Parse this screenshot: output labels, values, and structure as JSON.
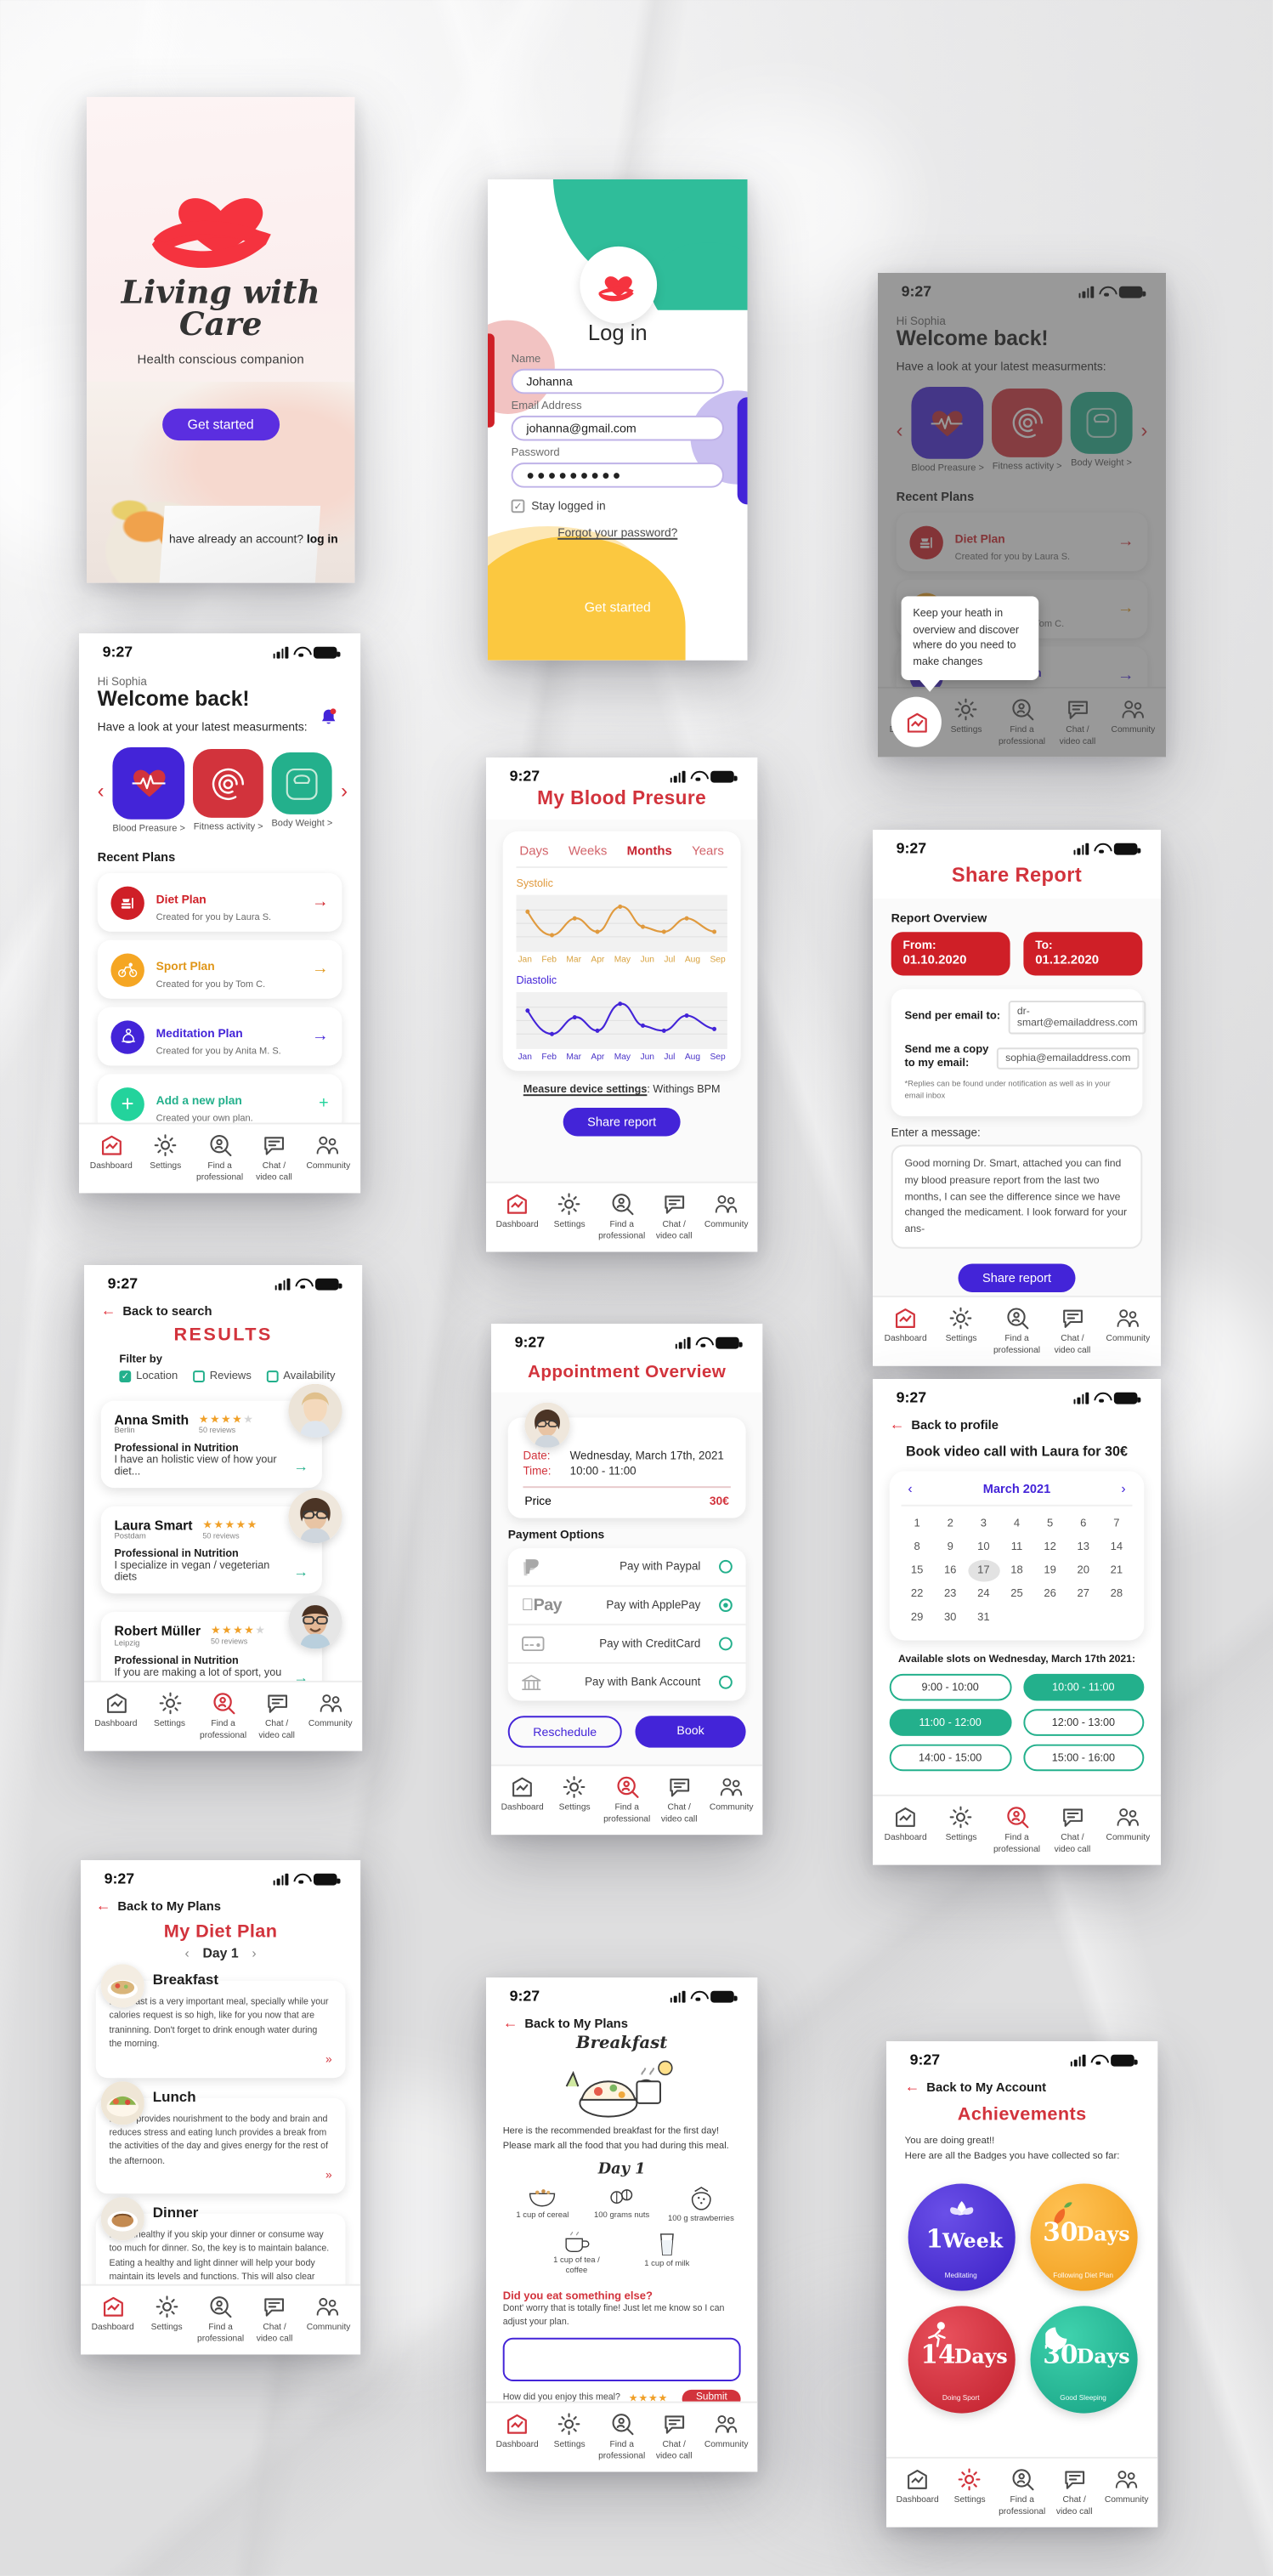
{
  "meta": {
    "status_time": "9:27"
  },
  "tabbar": {
    "items": [
      {
        "label": "Dashboard",
        "icon": "dashboard-icon"
      },
      {
        "label": "Settings",
        "icon": "gear-icon"
      },
      {
        "label": "Find a\nprofessional",
        "icon": "search-person-icon"
      },
      {
        "label": "Chat /\nvideo call",
        "icon": "chat-icon"
      },
      {
        "label": "Community",
        "icon": "community-icon"
      }
    ],
    "labels": {
      "dashboard": "Dashboard",
      "settings": "Settings",
      "find_line1": "Find a",
      "find_line2": "professional",
      "chat_line1": "Chat /",
      "chat_line2": "video call",
      "community": "Community"
    }
  },
  "splash": {
    "title_line1": "Living with",
    "title_line2": "Care",
    "tagline": "Health conscious companion",
    "cta": "Get started",
    "account_prompt": "have already an account?",
    "account_link": "log in",
    "logo_icon": "heart-in-hand-icon"
  },
  "login": {
    "title": "Log in",
    "name_label": "Name",
    "name_value": "Johanna",
    "email_label": "Email Address",
    "email_value": "johanna@gmail.com",
    "password_label": "Password",
    "password_value": "●●●●●●●●●",
    "stay_logged_in": "Stay logged in",
    "stay_checked": true,
    "forgot": "Forgot your password?",
    "cta": "Get started",
    "logo_icon": "heart-in-hand-icon"
  },
  "dashboard": {
    "greeting": "Hi Sophia",
    "welcome": "Welcome back!",
    "subtitle": "Have a look at your latest measurments:",
    "tiles": [
      {
        "label": "Blood Preasure >",
        "color": "#4324d8",
        "icon": "heartbeat-icon"
      },
      {
        "label": "Fitness activity >",
        "color": "#d2333c",
        "icon": "activity-rings-icon"
      },
      {
        "label": "Body Weight >",
        "color": "#23b08c",
        "icon": "scale-icon"
      }
    ],
    "recent_plans_title": "Recent Plans",
    "plans": [
      {
        "name": "Diet Plan",
        "by": "Created for you by Laura S.",
        "color": "#cf1f27",
        "icon": "food-icon",
        "arrow": "→"
      },
      {
        "name": "Sport Plan",
        "by": "Created for you by Tom C.",
        "color": "#f5a623",
        "icon": "bike-icon",
        "arrow": "→"
      },
      {
        "name": "Meditation Plan",
        "by": "Created for you by Anita M. S.",
        "color": "#4324d8",
        "icon": "meditation-icon",
        "arrow": "→"
      },
      {
        "name": "Add a new plan",
        "by": "Created your own plan.",
        "color": "#23b08c",
        "icon": "plus-icon",
        "arrow": "+"
      }
    ],
    "tooltip": "Keep your heath in overview and discover where do you need to make changes",
    "bell_icon": "notification-bell-icon"
  },
  "blood_pressure": {
    "title": "My Blood Presure",
    "segments": [
      "Days",
      "Weeks",
      "Months",
      "Years"
    ],
    "active_segment": "Months",
    "device_label": "Measure device settings",
    "device_value": "Withings BPM",
    "share_cta": "Share report",
    "chart_data": [
      {
        "type": "line",
        "title": "Systolic",
        "categories": [
          "Jan",
          "Feb",
          "Mar",
          "Apr",
          "May",
          "Jun",
          "Jul",
          "Aug",
          "Sep"
        ],
        "values": [
          132,
          118,
          128,
          119,
          136,
          124,
          120,
          127,
          119
        ],
        "color": "#e09a3e",
        "xlabel": "",
        "ylabel": "",
        "ylim": [
          110,
          140
        ],
        "grid": true,
        "legend": "none"
      },
      {
        "type": "line",
        "title": "Diastolic",
        "categories": [
          "Jan",
          "Feb",
          "Mar",
          "Apr",
          "May",
          "Jun",
          "Jul",
          "Aug",
          "Sep"
        ],
        "values": [
          86,
          74,
          82,
          76,
          90,
          80,
          77,
          85,
          79
        ],
        "color": "#4324d8",
        "xlabel": "",
        "ylabel": "",
        "ylim": [
          70,
          92
        ],
        "grid": true,
        "legend": "none"
      }
    ]
  },
  "share_report": {
    "title": "Share Report",
    "overview_label": "Report Overview",
    "from_label": "From:",
    "from_value": "01.10.2020",
    "to_label": "To:",
    "to_value": "01.12.2020",
    "send_to_label": "Send per email to:",
    "send_to_value": "dr-smart@emailaddress.com",
    "copy_label_l1": "Send me a copy",
    "copy_label_l2": "to my email:",
    "copy_value": "sophia@emailaddress.com",
    "note": "*Replies can be found under notification as well as in your email inbox",
    "message_label": "Enter a message:",
    "message_value": "Good morning Dr. Smart, attached you can find my blood preasure report from the last two months, I can see the difference since we have changed the medicament. I look forward for your ans-",
    "share_cta": "Share report"
  },
  "results": {
    "back": "Back to search",
    "title": "RESULTS",
    "filter_label": "Filter by",
    "filters": [
      {
        "label": "Location",
        "checked": true
      },
      {
        "label": "Reviews",
        "checked": false
      },
      {
        "label": "Availability",
        "checked": false
      }
    ],
    "people": [
      {
        "name": "Anna Smith",
        "city": "Berlin",
        "stars": 4,
        "reviews": "50 reviews",
        "profession": "Professional in Nutrition",
        "desc": "I have an holistic view of how your diet..."
      },
      {
        "name": "Laura Smart",
        "city": "Postdam",
        "stars": 5,
        "reviews": "50 reviews",
        "profession": "Professional in Nutrition",
        "desc": "I specialize in vegan / vegeterian diets"
      },
      {
        "name": "Robert Müller",
        "city": "Leipzig",
        "stars": 4,
        "reviews": "50 reviews",
        "profession": "Professional in Nutrition",
        "desc": "If you are making a lot of sport, you pro-"
      }
    ]
  },
  "appointment": {
    "title": "Appointment Overview",
    "date_label": "Date:",
    "date_value": "Wednesday, March 17th, 2021",
    "time_label": "Time:",
    "time_value": "10:00 - 11:00",
    "price_label": "Price",
    "price_value": "30€",
    "payment_title": "Payment Options",
    "options": [
      {
        "label": "Pay with Paypal",
        "icon": "paypal-icon",
        "selected": false
      },
      {
        "label": "Pay with ApplePay",
        "icon": "applepay-icon",
        "selected": true
      },
      {
        "label": "Pay with CreditCard",
        "icon": "creditcard-icon",
        "selected": false
      },
      {
        "label": "Pay with Bank Account",
        "icon": "bank-icon",
        "selected": false
      }
    ],
    "reschedule": "Reschedule",
    "book": "Book"
  },
  "booking": {
    "back": "Back to profile",
    "heading": "Book video call with Laura for 30€",
    "month": "March 2021",
    "prev": "‹",
    "next": "›",
    "days": [
      "1",
      "2",
      "3",
      "4",
      "5",
      "6",
      "7",
      "8",
      "9",
      "10",
      "11",
      "12",
      "13",
      "14",
      "15",
      "16",
      "17",
      "18",
      "19",
      "20",
      "21",
      "22",
      "23",
      "24",
      "25",
      "26",
      "27",
      "28",
      "29",
      "30",
      "31"
    ],
    "selected_day": "17",
    "slots_label": "Available slots on Wednesday, March 17th 2021:",
    "slots": [
      {
        "label": "9:00 - 10:00",
        "selected": false
      },
      {
        "label": "10:00 - 11:00",
        "selected": true
      },
      {
        "label": "11:00 - 12:00",
        "selected": true
      },
      {
        "label": "12:00 - 13:00",
        "selected": false
      },
      {
        "label": "14:00 - 15:00",
        "selected": false
      },
      {
        "label": "15:00 - 16:00",
        "selected": false
      }
    ]
  },
  "diet_plan": {
    "back": "Back to My Plans",
    "title": "My Diet Plan",
    "day": "Day 1",
    "prev": "‹",
    "next": "›",
    "meals": [
      {
        "name": "Breakfast",
        "text": "Breakfast is a very important meal, specially while your calories request is so high, like for you now that are traninning. Don't forget to drink enough water during the morning.",
        "more": "»"
      },
      {
        "name": "Lunch",
        "text": "Lunch provides nourishment to the body and brain and reduces stress and eating lunch provides a break from the activities of the day and gives energy for the rest of the afternoon.",
        "more": "»"
      },
      {
        "name": "Dinner",
        "text": "It is unhealthy if you skip your dinner or consume way too much for dinner. So, the key is to maintain balance. Eating a healthy and light dinner will help your body maintain its levels and functions. This will also clear your bowels.",
        "more": "»"
      }
    ]
  },
  "breakfast": {
    "back": "Back to My Plans",
    "title": "Breakfast",
    "intro": "Here is the recommended breakfast for the first day! Please mark all the food that you had during this meal.",
    "day": "Day 1",
    "items": [
      {
        "label": "1 cup of cereal",
        "icon": "cereal-bowl-icon"
      },
      {
        "label": "100 grams nuts",
        "icon": "nuts-icon"
      },
      {
        "label": "100 g strawberries",
        "icon": "strawberry-icon"
      },
      {
        "label": "1 cup of tea / coffee",
        "icon": "teacup-icon"
      },
      {
        "label": "1 cup of milk",
        "icon": "milk-glass-icon"
      }
    ],
    "question": "Did you eat something else?",
    "question_sub": "Dont' worry that is totally fine! Just let me know so I can adjust your plan.",
    "rating_label": "How did you enjoy this meal?",
    "rating_stars": "★★★★",
    "submit": "Submit"
  },
  "achievements": {
    "back": "Back to My Account",
    "title": "Achievements",
    "lead1": "You are doing great!!",
    "lead2": "Here are all the Badges you have collected so far:",
    "badges": [
      {
        "num": "1",
        "unit": "Week",
        "caption": "Meditating",
        "color": "#4324d8",
        "icon": "lotus-icon"
      },
      {
        "num": "30",
        "unit": "Days",
        "caption": "Following Diet Plan",
        "color": "#f5a623",
        "icon": "carrot-icon"
      },
      {
        "num": "14",
        "unit": "Days",
        "caption": "Doing Sport",
        "color": "#d2333c",
        "icon": "runner-icon"
      },
      {
        "num": "30",
        "unit": "Days",
        "caption": "Good Sleeping",
        "color": "#23b08c",
        "icon": "moon-icon"
      }
    ]
  }
}
